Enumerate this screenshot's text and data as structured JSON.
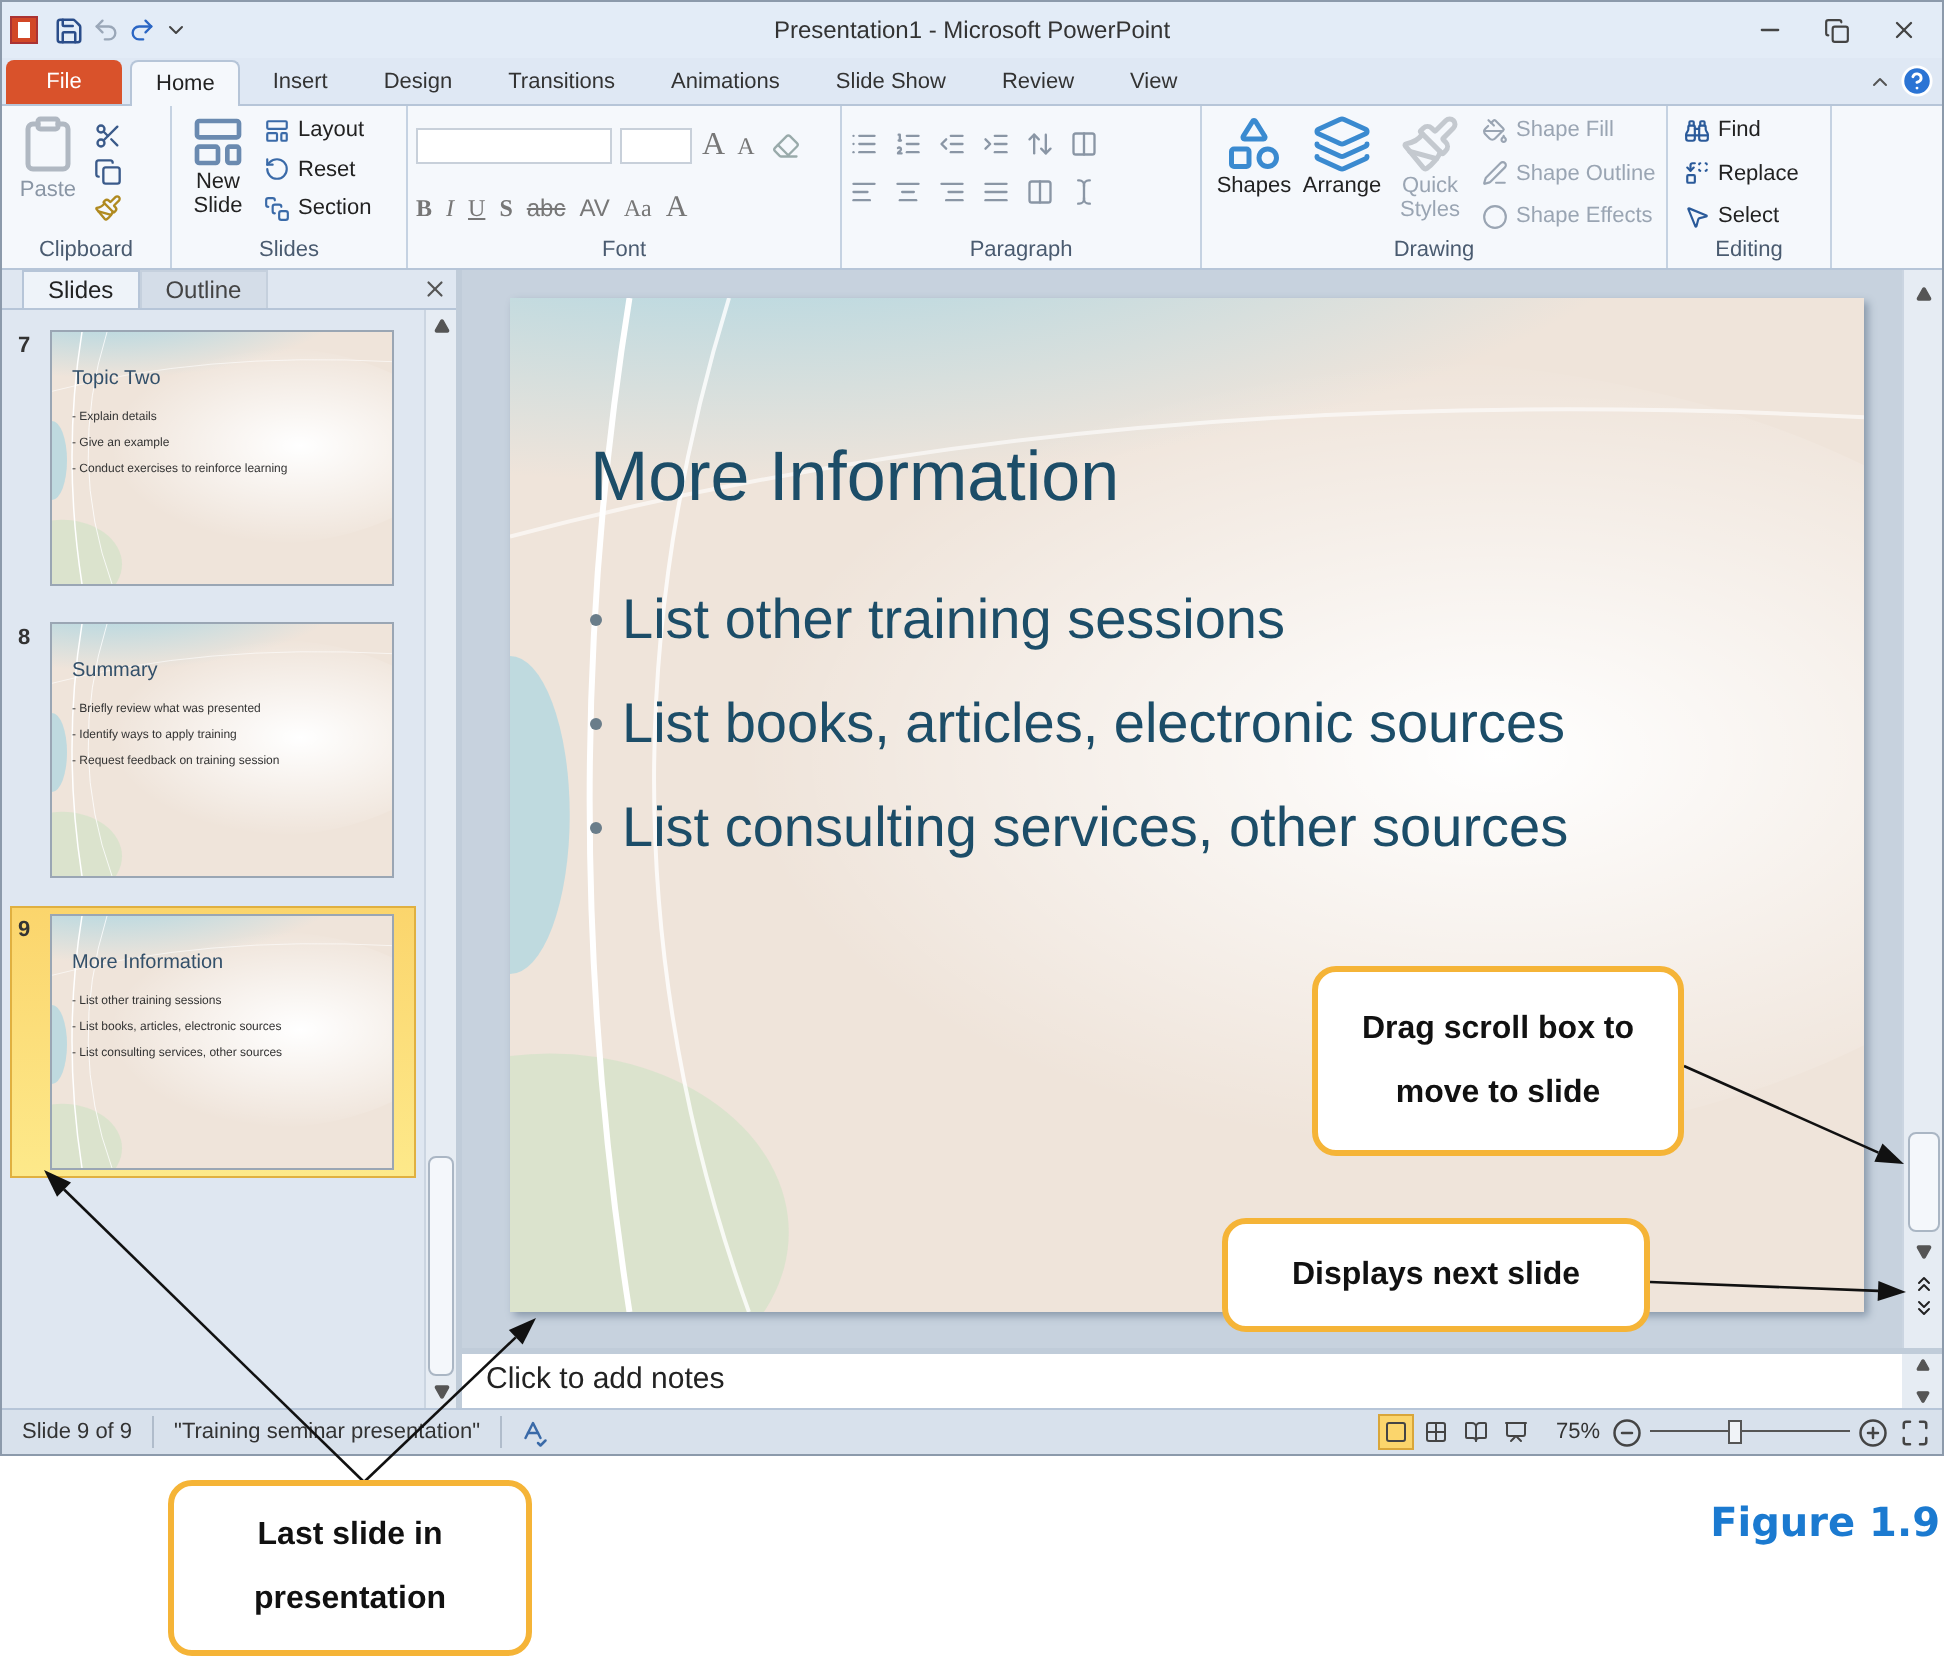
{
  "window": {
    "title": "Presentation1 - Microsoft PowerPoint"
  },
  "tabs": [
    {
      "label": "File",
      "kind": "file",
      "selected": false
    },
    {
      "label": "Home",
      "kind": "tab",
      "selected": true
    },
    {
      "label": "Insert",
      "kind": "tab",
      "selected": false
    },
    {
      "label": "Design",
      "kind": "tab",
      "selected": false
    },
    {
      "label": "Transitions",
      "kind": "tab",
      "selected": false
    },
    {
      "label": "Animations",
      "kind": "tab",
      "selected": false
    },
    {
      "label": "Slide Show",
      "kind": "tab",
      "selected": false
    },
    {
      "label": "Review",
      "kind": "tab",
      "selected": false
    },
    {
      "label": "View",
      "kind": "tab",
      "selected": false
    }
  ],
  "ribbon": {
    "clipboard": {
      "label": "Clipboard",
      "paste": "Paste"
    },
    "slides": {
      "label": "Slides",
      "new_slide": "New Slide",
      "commands": [
        "Layout",
        "Reset",
        "Section"
      ]
    },
    "font": {
      "label": "Font",
      "size_buttons": [
        {
          "label": "A",
          "kind": "grow"
        },
        {
          "label": "A",
          "kind": "shrink"
        }
      ],
      "format_buttons": [
        {
          "label": "B",
          "kind": "bold"
        },
        {
          "label": "I",
          "kind": "italic"
        },
        {
          "label": "U",
          "kind": "underline"
        },
        {
          "label": "S",
          "kind": "shadow"
        },
        {
          "label": "abc",
          "kind": "strike"
        },
        {
          "label": "AV",
          "kind": "spacing"
        },
        {
          "label": "Aa",
          "kind": "case"
        },
        {
          "label": "A",
          "kind": "color"
        }
      ]
    },
    "paragraph": {
      "label": "Paragraph"
    },
    "drawing": {
      "label": "Drawing",
      "large": [
        {
          "label": "Shapes",
          "disabled": false
        },
        {
          "label": "Arrange",
          "disabled": false
        },
        {
          "label": "Quick Styles",
          "disabled": true
        }
      ],
      "commands": [
        {
          "label": "Shape Fill",
          "disabled": true
        },
        {
          "label": "Shape Outline",
          "disabled": true
        },
        {
          "label": "Shape Effects",
          "disabled": true
        }
      ]
    },
    "editing": {
      "label": "Editing",
      "commands": [
        "Find",
        "Replace",
        "Select"
      ]
    }
  },
  "slides_pane": {
    "tabs": [
      {
        "label": "Slides",
        "selected": true
      },
      {
        "label": "Outline",
        "selected": false
      }
    ],
    "thumbnails": [
      {
        "number": "7",
        "title": "Topic Two",
        "bullets": [
          "- Explain details",
          "- Give an example",
          "- Conduct exercises to reinforce learning"
        ],
        "selected": false
      },
      {
        "number": "8",
        "title": "Summary",
        "bullets": [
          "- Briefly review what was presented",
          "- Identify ways to apply training",
          "- Request feedback on training session"
        ],
        "selected": false
      },
      {
        "number": "9",
        "title": "More Information",
        "bullets": [
          "- List other training sessions",
          "- List books, articles, electronic sources",
          "- List consulting services, other sources"
        ],
        "selected": true
      }
    ]
  },
  "slide": {
    "title": "More Information",
    "bullets": [
      "List other training sessions",
      "List books, articles, electronic sources",
      "List consulting services, other sources"
    ]
  },
  "notes": {
    "placeholder": "Click to add notes"
  },
  "status_bar": {
    "slide": "Slide 9 of 9",
    "theme": "\"Training seminar presentation\"",
    "views": [
      {
        "kind": "normal",
        "selected": true
      },
      {
        "kind": "sorter",
        "selected": false
      },
      {
        "kind": "reading",
        "selected": false
      },
      {
        "kind": "show",
        "selected": false
      }
    ],
    "zoom": "75%",
    "zoom_slider": {
      "level": 0.42
    }
  },
  "callouts": [
    {
      "text": "Drag scroll box to move to slide"
    },
    {
      "text": "Displays next slide"
    },
    {
      "text": "Last slide in presentation"
    }
  ],
  "figure_label": "Figure 1.9"
}
